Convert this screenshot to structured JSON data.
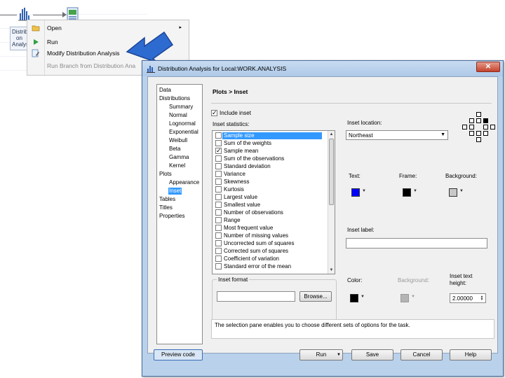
{
  "process_flow": {
    "node_label_lines": [
      "Distrib",
      "on",
      "Analys"
    ]
  },
  "context_menu": {
    "items": [
      {
        "label": "Open",
        "icon": "open-folder-icon",
        "has_submenu": true
      },
      {
        "label": "Run",
        "icon": "run-play-icon"
      },
      {
        "label": "Modify Distribution Analysis",
        "icon": "modify-task-icon"
      },
      {
        "label": "Run Branch from Distribution Ana",
        "icon": "",
        "disabled": true
      }
    ]
  },
  "dialog": {
    "title": "Distribution Analysis for Local:WORK.ANALYSIS",
    "close_label": "✕",
    "nav": [
      {
        "label": "Data",
        "level": 0
      },
      {
        "label": "Distributions",
        "level": 0
      },
      {
        "label": "Summary",
        "level": 1
      },
      {
        "label": "Normal",
        "level": 1
      },
      {
        "label": "Lognormal",
        "level": 1
      },
      {
        "label": "Exponential",
        "level": 1
      },
      {
        "label": "Weibull",
        "level": 1
      },
      {
        "label": "Beta",
        "level": 1
      },
      {
        "label": "Gamma",
        "level": 1
      },
      {
        "label": "Kernel",
        "level": 1
      },
      {
        "label": "Plots",
        "level": 0
      },
      {
        "label": "Appearance",
        "level": 1
      },
      {
        "label": "Inset",
        "level": 1,
        "selected": true
      },
      {
        "label": "Tables",
        "level": 0
      },
      {
        "label": "Titles",
        "level": 0
      },
      {
        "label": "Properties",
        "level": 0
      }
    ],
    "heading": "Plots > Inset",
    "include_inset_label": "Include inset",
    "include_inset_checked": true,
    "inset_statistics_label": "Inset statistics:",
    "statistics": [
      {
        "label": "Sample size",
        "checked": false,
        "selected": true
      },
      {
        "label": "Sum of the weights",
        "checked": false
      },
      {
        "label": "Sample mean",
        "checked": true
      },
      {
        "label": "Sum of the observations",
        "checked": false
      },
      {
        "label": "Standard deviation",
        "checked": false
      },
      {
        "label": "Variance",
        "checked": false
      },
      {
        "label": "Skewness",
        "checked": false
      },
      {
        "label": "Kurtosis",
        "checked": false
      },
      {
        "label": "Largest value",
        "checked": false
      },
      {
        "label": "Smallest value",
        "checked": false
      },
      {
        "label": "Number of observations",
        "checked": false
      },
      {
        "label": "Range",
        "checked": false
      },
      {
        "label": "Most frequent value",
        "checked": false
      },
      {
        "label": "Number of missing values",
        "checked": false
      },
      {
        "label": "Uncorrected sum of squares",
        "checked": false
      },
      {
        "label": "Corrected sum of squares",
        "checked": false
      },
      {
        "label": "Coefficient of variation",
        "checked": false
      },
      {
        "label": "Standard error of the mean",
        "checked": false
      }
    ],
    "inset_format_label": "Inset format",
    "inset_format_value": "",
    "browse_label": "Browse...",
    "inset_location_label": "Inset location:",
    "inset_location_value": "Northeast",
    "text_label": "Text:",
    "frame_label": "Frame:",
    "background_label": "Background:",
    "colors": {
      "text": "#0000ff",
      "frame": "#000000",
      "background": "#c8c8c8",
      "label_color": "#000000",
      "label_background": "#b4b4b4"
    },
    "inset_label_label": "Inset label:",
    "inset_label_value": "",
    "color_label": "Color:",
    "label_background_label": "Background:",
    "inset_text_height_label": "Inset text height:",
    "inset_text_height_value": "2.00000",
    "help_text": "The selection pane enables you to choose different sets of options for the task.",
    "buttons": {
      "preview": "Preview code",
      "run": "Run",
      "save": "Save",
      "cancel": "Cancel",
      "help": "Help"
    }
  }
}
